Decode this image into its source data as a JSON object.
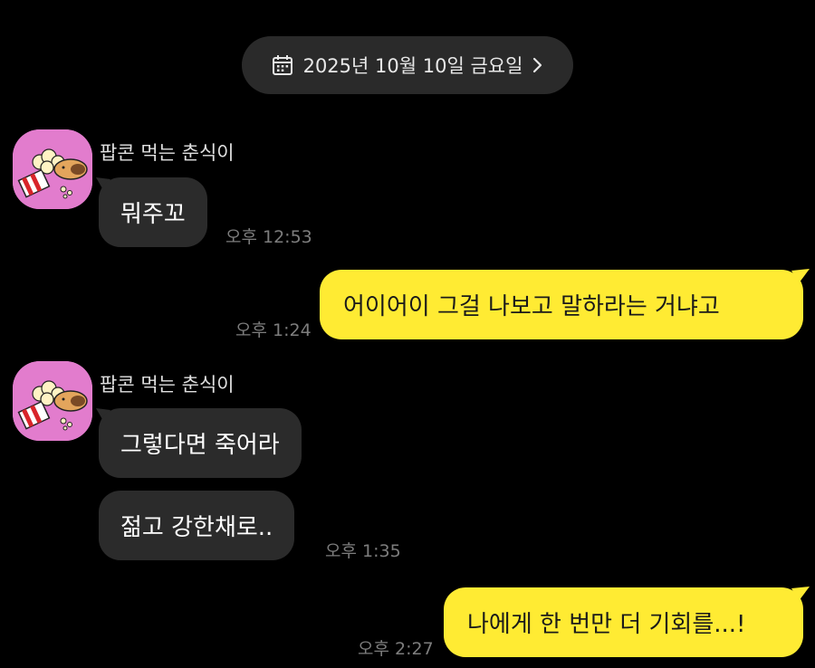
{
  "date_header": {
    "label": "2025년 10월 10일 금요일",
    "icon": "calendar-icon",
    "chevron": "chevron-right-icon"
  },
  "colors": {
    "background": "#000000",
    "incoming_bubble": "#2b2b2b",
    "outgoing_bubble": "#ffeb33",
    "avatar_bg": "#e27ccd"
  },
  "messages": [
    {
      "group": 1,
      "sender": "팝콘 먹는 춘식이",
      "direction": "incoming",
      "text": "뭐주꼬",
      "time": "오후 12:53"
    },
    {
      "direction": "outgoing",
      "text": "어이어이 그걸 나보고 말하라는 거냐고",
      "time": "오후 1:24"
    },
    {
      "group": 2,
      "sender": "팝콘 먹는 춘식이",
      "direction": "incoming",
      "text": "그렇다면 죽어라"
    },
    {
      "group": 2,
      "direction": "incoming",
      "text": "젊고 강한채로..",
      "time": "오후 1:35"
    },
    {
      "direction": "outgoing",
      "text": "나에게 한 번만 더 기회를...!",
      "time": "오후 2:27"
    }
  ]
}
